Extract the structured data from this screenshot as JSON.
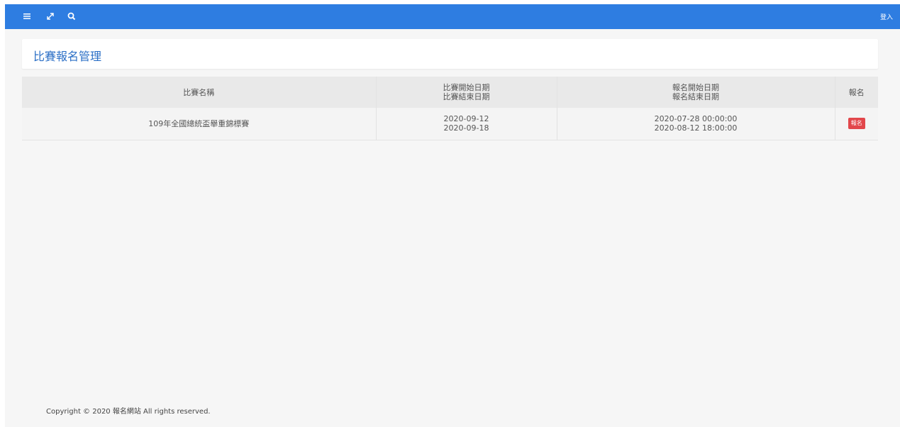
{
  "topbar": {
    "icons": [
      "menu-icon",
      "expand-icon",
      "search-icon"
    ],
    "login_label": "登入",
    "color": "#2e7de1"
  },
  "page": {
    "title": "比賽報名管理",
    "title_color": "#2b6fc6"
  },
  "table": {
    "headers": {
      "name": "比賽名稱",
      "match_start": "比賽開始日期",
      "match_end": "比賽結束日期",
      "reg_start": "報名開始日期",
      "reg_end": "報名結束日期",
      "action": "報名"
    },
    "rows": [
      {
        "name": "109年全國總統盃舉重錦標賽",
        "match_start": "2020-09-12",
        "match_end": "2020-09-18",
        "reg_start": "2020-07-28 00:00:00",
        "reg_end": "2020-08-12 18:00:00",
        "action_label": "報名"
      }
    ]
  },
  "footer": {
    "text": "Copyright © 2020 報名網站 All rights reserved."
  },
  "colors": {
    "badge": "#e2474b",
    "background": "#f6f6f6"
  }
}
